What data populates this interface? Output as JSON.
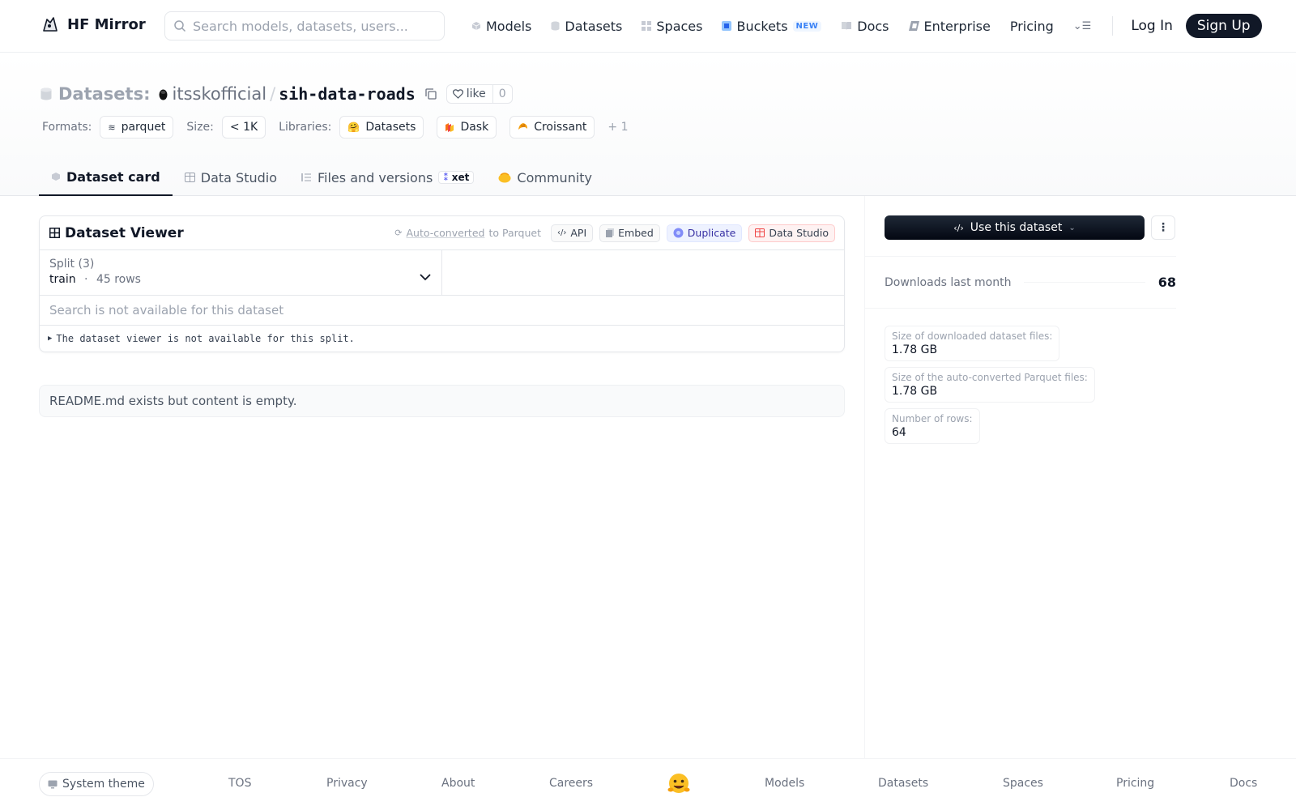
{
  "nav": {
    "brand": "HF Mirror",
    "search_placeholder": "Search models, datasets, users...",
    "items": [
      {
        "label": "Models",
        "icon": "cube-icon"
      },
      {
        "label": "Datasets",
        "icon": "database-icon"
      },
      {
        "label": "Spaces",
        "icon": "grid-icon"
      },
      {
        "label": "Buckets",
        "icon": "bucket-icon",
        "badge": "NEW"
      },
      {
        "label": "Docs",
        "icon": "book-icon"
      },
      {
        "label": "Enterprise",
        "icon": "building-icon"
      },
      {
        "label": "Pricing"
      }
    ],
    "login": "Log In",
    "signup": "Sign Up"
  },
  "header": {
    "section": "Datasets:",
    "owner": "itsskofficial",
    "separator": "/",
    "repo": "sih-data-roads",
    "like_label": "like",
    "like_count": "0",
    "formats_label": "Formats:",
    "format": "parquet",
    "size_label": "Size:",
    "size": "< 1K",
    "libraries_label": "Libraries:",
    "libraries": [
      "Datasets",
      "Dask",
      "Croissant"
    ],
    "libraries_more": "+ 1"
  },
  "tabs": [
    {
      "label": "Dataset card",
      "active": true
    },
    {
      "label": "Data Studio"
    },
    {
      "label": "Files and versions",
      "badge": "xet"
    },
    {
      "label": "Community"
    }
  ],
  "viewer": {
    "title": "Dataset Viewer",
    "auto_converted": "Auto-converted",
    "to_parquet": "to Parquet",
    "buttons": {
      "api": "API",
      "embed": "Embed",
      "duplicate": "Duplicate",
      "studio": "Data Studio"
    },
    "split_label": "Split (3)",
    "split_name": "train",
    "split_dot": "·",
    "split_rows": "45 rows",
    "search_msg": "Search is not available for this dataset",
    "error_msg": "The dataset viewer is not available for this split."
  },
  "readme_msg": "README.md exists but content is empty.",
  "sidebar": {
    "use_button": "Use this dataset",
    "downloads_label": "Downloads last month",
    "downloads_value": "68",
    "stats": [
      {
        "key": "Size of downloaded dataset files:",
        "value": "1.78 GB"
      },
      {
        "key": "Size of the auto-converted Parquet files:",
        "value": "1.78 GB"
      },
      {
        "key": "Number of rows:",
        "value": "64"
      }
    ]
  },
  "footer": {
    "theme": "System theme",
    "links": [
      "TOS",
      "Privacy",
      "About",
      "Careers",
      "Models",
      "Datasets",
      "Spaces",
      "Pricing",
      "Docs"
    ]
  },
  "colors": {
    "accent": "#111827",
    "new_badge": "#3b82f6",
    "duplicate_bg": "#eef2ff",
    "studio_bg": "#fef2f2"
  }
}
